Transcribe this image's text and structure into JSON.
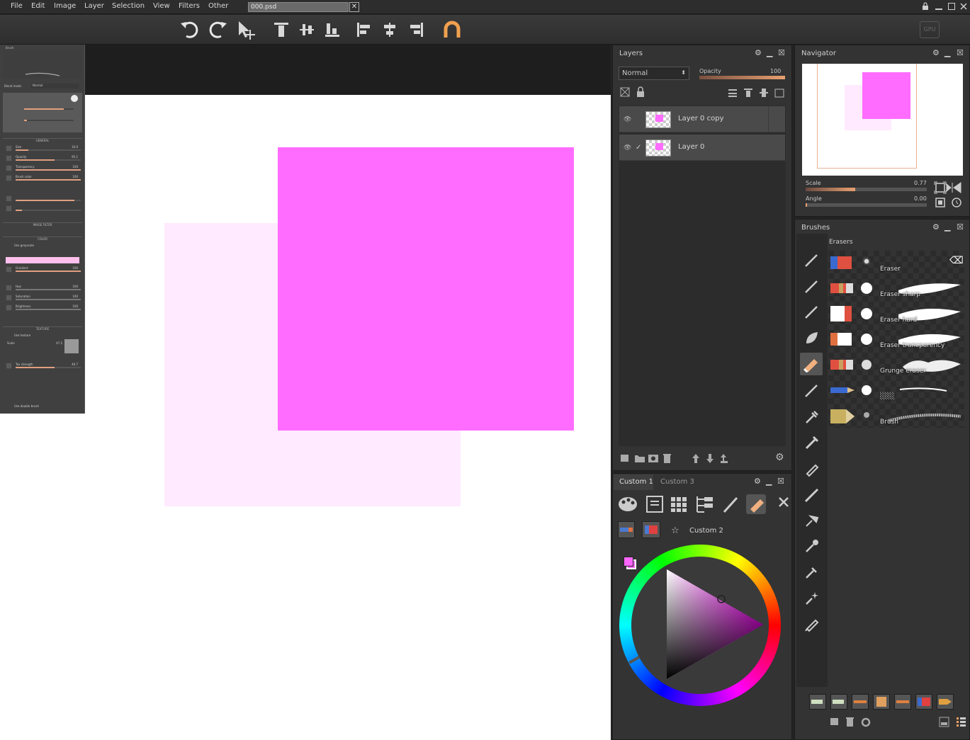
{
  "menu": {
    "items": [
      "File",
      "Edit",
      "Image",
      "Layer",
      "Selection",
      "View",
      "Filters",
      "Other"
    ],
    "document_tab": "000.psd",
    "close_glyph": "✕"
  },
  "toolbar": {
    "icons": [
      "undo-icon",
      "redo-icon",
      "move-icon",
      "align-top-icon",
      "align-vcenter-icon",
      "align-bottom-icon",
      "align-left-icon",
      "align-hcenter-icon",
      "align-right-icon",
      "magnet-icon"
    ],
    "gpu_badge": "GPU"
  },
  "brush_panel": {
    "title": "Brush",
    "rows": [
      {
        "label": "Blend mode",
        "value": "Normal"
      },
      {
        "label": "Size",
        "value": "10.0"
      },
      {
        "label": "Opacity",
        "value": "95.1"
      },
      {
        "label": "Transparency",
        "value": "100"
      },
      {
        "label": "Brush color",
        "value": "100"
      },
      {
        "label": "Use greyscale",
        "value": ""
      },
      {
        "label": "Gradient",
        "value": "100"
      },
      {
        "label": "Hue",
        "value": "100"
      },
      {
        "label": "Saturation",
        "value": "100"
      },
      {
        "label": "Brightness",
        "value": "100"
      },
      {
        "label": "Use texture",
        "value": ""
      },
      {
        "label": "Scale",
        "value": "47.2"
      },
      {
        "label": "Tex strength",
        "value": "46.7"
      },
      {
        "label": "Use double brush",
        "value": ""
      }
    ],
    "sections": [
      "GENERAL",
      "IMAGE FILTER",
      "COLOR",
      "TEXTURE"
    ]
  },
  "layers": {
    "title": "Layers",
    "blend_mode": "Normal",
    "opacity_label": "Opacity",
    "opacity_value": "100",
    "items": [
      {
        "name": "Layer 0 copy",
        "checked": false
      },
      {
        "name": "Layer 0",
        "checked": true
      }
    ]
  },
  "navigator": {
    "title": "Navigator",
    "scale_label": "Scale",
    "scale_value": "0.77",
    "angle_label": "Angle",
    "angle_value": "0.00"
  },
  "custom_panel": {
    "tabs": [
      "Custom 1",
      "Custom 3"
    ],
    "favorite_label": "Custom 2"
  },
  "brushes": {
    "title": "Brushes",
    "category": "Erasers",
    "items": [
      "Eraser",
      "Eraser sharp",
      "Eraser hard",
      "Eraser trancparency",
      "Grunge eraser",
      "░░░",
      "Brush"
    ]
  },
  "colors": {
    "primary": "#ff66ff",
    "canvas_square": "#ff6cff",
    "canvas_square_faded": "#ffeaff",
    "accent": "#e8a070"
  }
}
